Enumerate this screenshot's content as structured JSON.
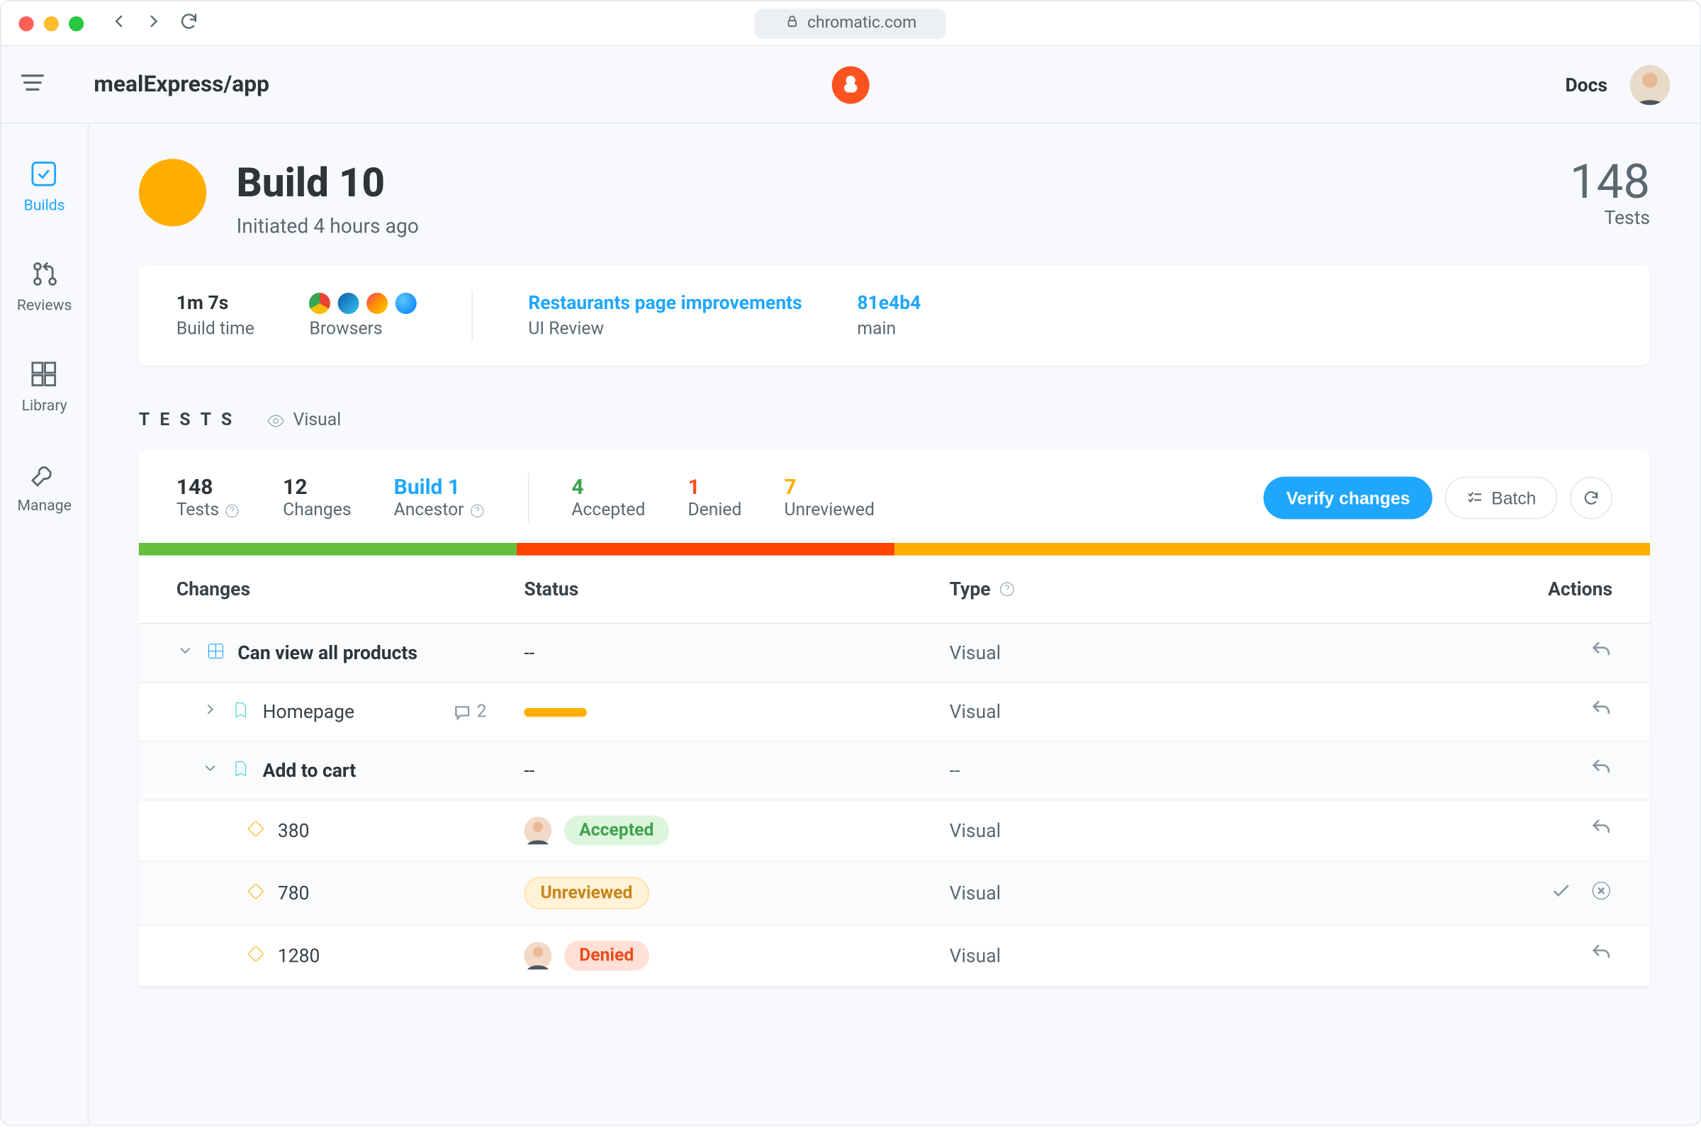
{
  "chrome": {
    "domain": "chromatic.com"
  },
  "header": {
    "project": "mealExpress/app",
    "docs": "Docs"
  },
  "sidebar": {
    "items": [
      {
        "label": "Builds",
        "icon": "check-square",
        "active": true
      },
      {
        "label": "Reviews",
        "icon": "pull-request",
        "active": false
      },
      {
        "label": "Library",
        "icon": "grid",
        "active": false
      },
      {
        "label": "Manage",
        "icon": "wrench",
        "active": false
      }
    ]
  },
  "page": {
    "title": "Build 10",
    "subtitle": "Initiated 4 hours ago",
    "tests_count": "148",
    "tests_count_label": "Tests"
  },
  "meta": {
    "build_time": {
      "value": "1m 7s",
      "label": "Build time"
    },
    "browsers": {
      "label": "Browsers",
      "list": [
        "chrome",
        "edge",
        "firefox",
        "safari"
      ]
    },
    "review": {
      "title": "Restaurants page improvements",
      "label": "UI Review"
    },
    "commit": {
      "hash": "81e4b4",
      "branch": "main"
    }
  },
  "tests_header": {
    "label": "TESTS",
    "filter": "Visual"
  },
  "stats": {
    "tests": {
      "n": "148",
      "l": "Tests"
    },
    "changes": {
      "n": "12",
      "l": "Changes"
    },
    "ancestor": {
      "n": "Build 1",
      "l": "Ancestor"
    },
    "accepted": {
      "n": "4",
      "l": "Accepted"
    },
    "denied": {
      "n": "1",
      "l": "Denied"
    },
    "unrev": {
      "n": "7",
      "l": "Unreviewed"
    }
  },
  "actions": {
    "verify": "Verify changes",
    "batch": "Batch"
  },
  "progress": {
    "green": 25,
    "red": 25,
    "amber": 50
  },
  "table": {
    "head": {
      "changes": "Changes",
      "status": "Status",
      "type": "Type",
      "actions": "Actions"
    },
    "rows": [
      {
        "kind": "group",
        "expanded": true,
        "indent": 0,
        "icon": "comp",
        "title": "Can view all products",
        "status": "--",
        "type": "Visual",
        "actions": [
          "undo"
        ],
        "shade": true
      },
      {
        "kind": "story",
        "expanded": false,
        "indent": 1,
        "icon": "book",
        "title": "Homepage",
        "comments": "2",
        "status": "bar",
        "type": "Visual",
        "actions": [
          "undo"
        ],
        "shade": false
      },
      {
        "kind": "group",
        "expanded": true,
        "indent": 1,
        "icon": "book",
        "title": "Add to cart",
        "status": "--",
        "type": "--",
        "actions": [
          "undo"
        ],
        "shade": true
      },
      {
        "kind": "vp",
        "indent": 2,
        "icon": "vp",
        "title": "380",
        "avatar": true,
        "pill": "Accepted",
        "pillClass": "accepted",
        "type": "Visual",
        "actions": [
          "undo"
        ],
        "shade": false
      },
      {
        "kind": "vp",
        "indent": 2,
        "icon": "vp",
        "title": "780",
        "pill": "Unreviewed",
        "pillClass": "unrev",
        "type": "Visual",
        "actions": [
          "check",
          "close"
        ],
        "shade": true
      },
      {
        "kind": "vp",
        "indent": 2,
        "icon": "vp",
        "title": "1280",
        "avatar": true,
        "pill": "Denied",
        "pillClass": "denied",
        "type": "Visual",
        "actions": [
          "undo"
        ],
        "shade": false
      }
    ]
  }
}
